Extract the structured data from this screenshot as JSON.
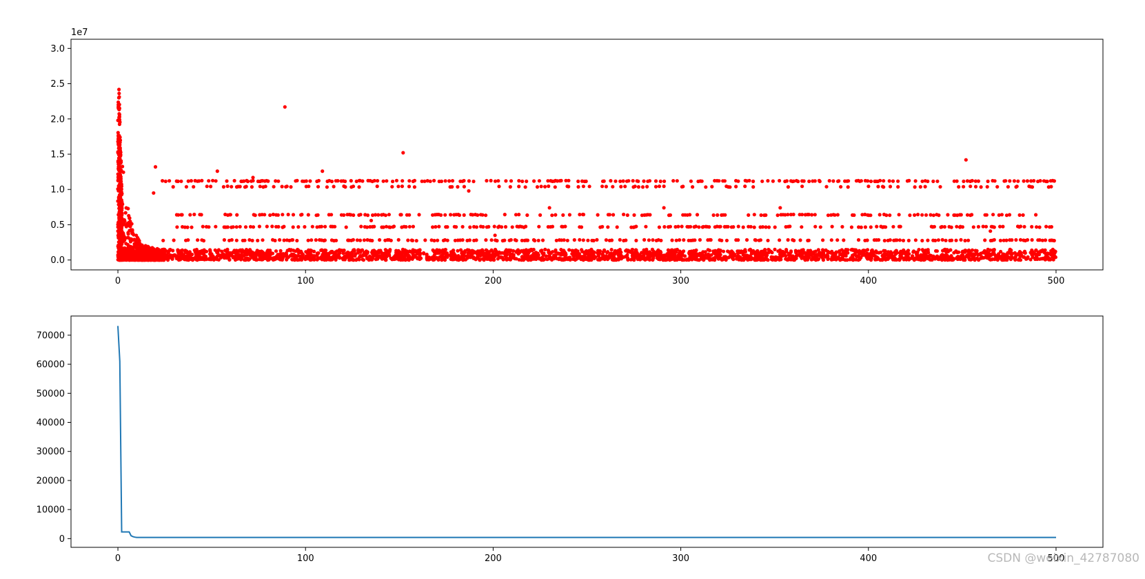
{
  "watermark": "CSDN @weixin_42787080",
  "chart_data": [
    {
      "type": "scatter",
      "xlim": [
        -25,
        525
      ],
      "ylim": [
        -1400000,
        31300000
      ],
      "offset_text": "1e7",
      "x_ticks": [
        0,
        100,
        200,
        300,
        400,
        500
      ],
      "x_tick_labels": [
        "0",
        "100",
        "200",
        "300",
        "400",
        "500"
      ],
      "y_ticks": [
        0,
        5000000,
        10000000,
        15000000,
        20000000,
        25000000,
        30000000
      ],
      "y_tick_labels": [
        "0.0",
        "0.5",
        "1.0",
        "1.5",
        "2.0",
        "2.5",
        "3.0"
      ],
      "marker_color": "#ff0000",
      "grid": false,
      "summary_bands": [
        {
          "y": 11200000,
          "x_range": [
            20,
            500
          ],
          "density": 0.45
        },
        {
          "y": 6400000,
          "x_range": [
            25,
            490
          ],
          "density": 0.4
        },
        {
          "y": 4700000,
          "x_range": [
            30,
            500
          ],
          "density": 0.4
        },
        {
          "y": 2800000,
          "x_range": [
            22,
            500
          ],
          "density": 0.4
        },
        {
          "y": 10400000,
          "x_range": [
            25,
            500
          ],
          "density": 0.25
        }
      ],
      "outliers": [
        {
          "x": 89,
          "y": 21700000
        },
        {
          "x": 152,
          "y": 15200000
        },
        {
          "x": 452,
          "y": 14200000
        },
        {
          "x": 53,
          "y": 12600000
        },
        {
          "x": 109,
          "y": 12600000
        },
        {
          "x": 72,
          "y": 11700000
        },
        {
          "x": 187,
          "y": 9800000
        },
        {
          "x": 230,
          "y": 7400000
        },
        {
          "x": 291,
          "y": 7400000
        },
        {
          "x": 353,
          "y": 7400000
        },
        {
          "x": 135,
          "y": 5600000
        },
        {
          "x": 201,
          "y": 3500000
        },
        {
          "x": 465,
          "y": 4100000
        },
        {
          "x": 20,
          "y": 13200000
        },
        {
          "x": 19,
          "y": 9500000
        }
      ]
    },
    {
      "type": "line",
      "xlim": [
        -25,
        525
      ],
      "ylim": [
        -3000,
        76600
      ],
      "x_ticks": [
        0,
        100,
        200,
        300,
        400,
        500
      ],
      "x_tick_labels": [
        "0",
        "100",
        "200",
        "300",
        "400",
        "500"
      ],
      "y_ticks": [
        0,
        10000,
        20000,
        30000,
        40000,
        50000,
        60000,
        70000
      ],
      "y_tick_labels": [
        "0",
        "10000",
        "20000",
        "30000",
        "40000",
        "50000",
        "60000",
        "70000"
      ],
      "line_color": "#1f77b4",
      "grid": false,
      "x": [
        0,
        1,
        2,
        3,
        4,
        5,
        6,
        7,
        8,
        9,
        10,
        500
      ],
      "y": [
        73200,
        61000,
        2300,
        2300,
        2300,
        2300,
        2300,
        1000,
        700,
        500,
        400,
        400
      ]
    }
  ]
}
